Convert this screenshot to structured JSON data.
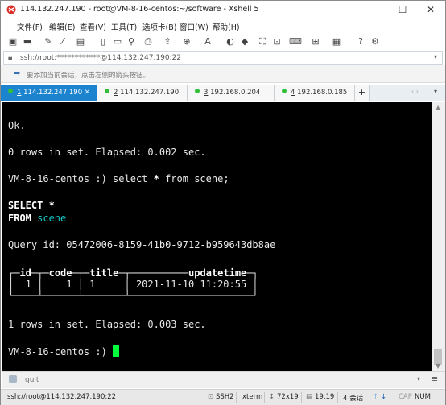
{
  "window": {
    "title": "114.132.247.190 - root@VM-8-16-centos:~/software - Xshell 5",
    "buttons": {
      "minimize": "—",
      "maximize": "☐",
      "close": "✕"
    }
  },
  "menu": [
    "文件(F)",
    "编辑(E)",
    "查看(V)",
    "工具(T)",
    "选项卡(B)",
    "窗口(W)",
    "帮助(H)"
  ],
  "address": {
    "text": "ssh://root:************@114.132.247.190:22"
  },
  "hint": {
    "text": "要添加当前会话，点击左侧的箭头按钮。"
  },
  "tabs": [
    {
      "number": "1",
      "label": "114.132.247.190",
      "active": true,
      "color": "#2fbf3a"
    },
    {
      "number": "2",
      "label": "114.132.247.190",
      "active": false,
      "color": "#2fbf3a"
    },
    {
      "number": "3",
      "label": "192.168.0.204",
      "active": false,
      "color": "#2fbf3a"
    },
    {
      "number": "4",
      "label": "192.168.0.185",
      "active": false,
      "color": "#2fbf3a"
    }
  ],
  "terminal": {
    "ok": "Ok.",
    "rows0": "0 rows in set. Elapsed: 0.002 sec.",
    "prompt1": "VM-8-16-centos :) ",
    "command_a": "select ",
    "command_star": "*",
    "command_b": " from scene;",
    "select_kw": "SELECT",
    "select_rest": " *",
    "from_kw": "FROM",
    "from_table": " scene",
    "query_id": "Query id: 05472006-8159-41b0-9712-b959643db8ae",
    "table_top": "┌─",
    "table_top_mid1": "─┬─",
    "table_top_mid2": "─┬─",
    "table_top_mid3": "─┬──────────",
    "table_top_end": "─┐",
    "col_id": "id",
    "col_code": "code",
    "col_title": "title",
    "col_updatetime": "updatetime",
    "row_line": "│  1 │    1 │ 1     │ 2021-11-10 11:20:55 │",
    "table_bottom": "└────┴──────┴───────┴─────────────────────┘",
    "rows1": "1 rows in set. Elapsed: 0.003 sec.",
    "prompt2": "VM-8-16-centos :) "
  },
  "command_input": {
    "text": "quit"
  },
  "status": {
    "address": "ssh://root@114.132.247.190:22",
    "protocol": "SSH2",
    "terminal_type": "xterm",
    "size": "72x19",
    "cursor": "19,19",
    "sessions": "4 会话",
    "cap": "CAP",
    "num": "NUM"
  }
}
